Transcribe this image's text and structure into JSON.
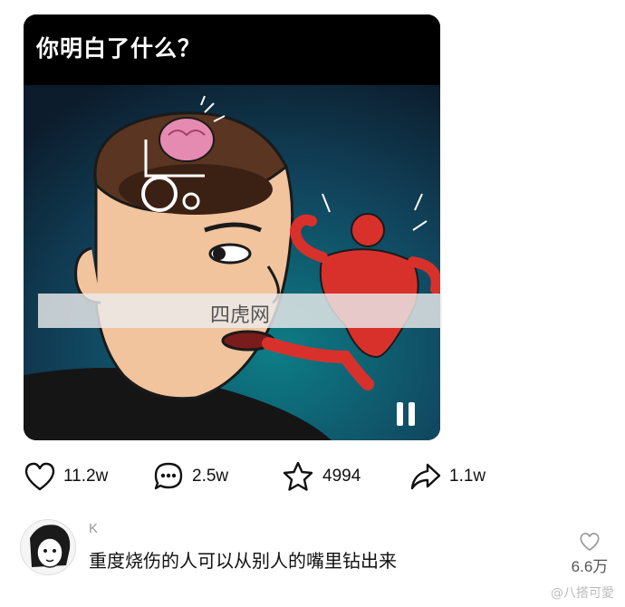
{
  "post": {
    "title": "你明白了什么？"
  },
  "watermark": {
    "text": "四虎网"
  },
  "actions": {
    "like_count": "11.2w",
    "comment_count": "2.5w",
    "favorite_count": "4994",
    "share_count": "1.1w"
  },
  "comment": {
    "username": "K",
    "text": "重度烧伤的人可以从别人的嘴里钻出来",
    "like_count": "6.6万"
  },
  "corner_watermark": "@八搭可愛",
  "colors": {
    "header_bg": "#000000",
    "image_bg_top": "#14324a",
    "image_bg_bottom": "#0b6a78",
    "red_figure": "#d8312c"
  }
}
